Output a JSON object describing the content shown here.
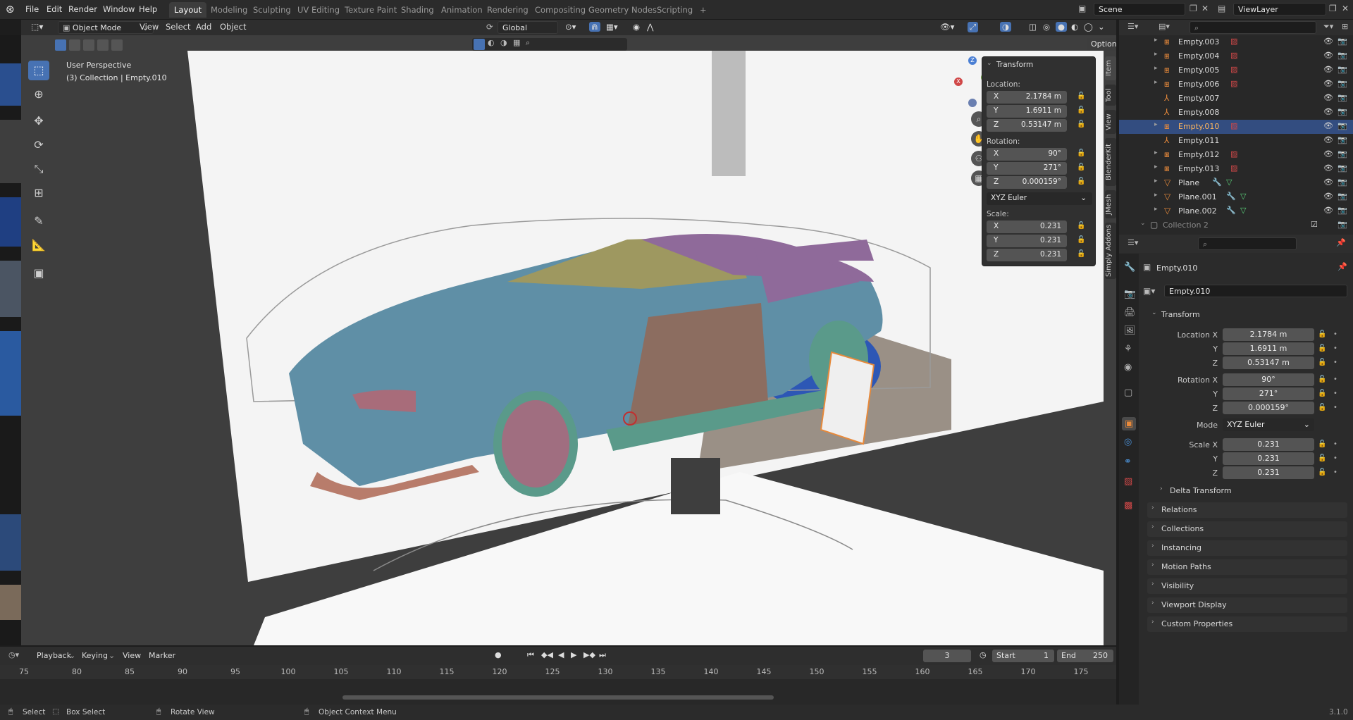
{
  "topbar": {
    "menus": [
      "File",
      "Edit",
      "Render",
      "Window",
      "Help"
    ],
    "workspaces": [
      "Layout",
      "Modeling",
      "Sculpting",
      "UV Editing",
      "Texture Paint",
      "Shading",
      "Animation",
      "Rendering",
      "Compositing",
      "Geometry Nodes",
      "Scripting"
    ],
    "active_workspace": "Layout",
    "add_tab": "+",
    "scene": "Scene",
    "view_layer": "ViewLayer"
  },
  "viewport_header": {
    "mode": "Object Mode",
    "menus": [
      "View",
      "Select",
      "Add",
      "Object"
    ],
    "orientation": "Global",
    "options": "Options"
  },
  "viewport": {
    "perspective": "User Perspective",
    "collection_info": "(3) Collection | Empty.010"
  },
  "npanel": {
    "title": "Transform",
    "location_label": "Location:",
    "location": [
      {
        "axis": "X",
        "value": "2.1784 m"
      },
      {
        "axis": "Y",
        "value": "1.6911 m"
      },
      {
        "axis": "Z",
        "value": "0.53147 m"
      }
    ],
    "rotation_label": "Rotation:",
    "rotation": [
      {
        "axis": "X",
        "value": "90°"
      },
      {
        "axis": "Y",
        "value": "271°"
      },
      {
        "axis": "Z",
        "value": "0.000159°"
      }
    ],
    "rotation_mode": "XYZ Euler",
    "scale_label": "Scale:",
    "scale": [
      {
        "axis": "X",
        "value": "0.231"
      },
      {
        "axis": "Y",
        "value": "0.231"
      },
      {
        "axis": "Z",
        "value": "0.231"
      }
    ],
    "tabs": [
      "Item",
      "Tool",
      "View",
      "BlenderKit",
      "JMesh",
      "Simply Addons"
    ]
  },
  "outliner": {
    "rows": [
      {
        "name": "Empty.003",
        "kind": "empty-image",
        "expand": true
      },
      {
        "name": "Empty.004",
        "kind": "empty-image",
        "expand": true
      },
      {
        "name": "Empty.005",
        "kind": "empty-image",
        "expand": true
      },
      {
        "name": "Empty.006",
        "kind": "empty-image",
        "expand": true
      },
      {
        "name": "Empty.007",
        "kind": "empty",
        "expand": false
      },
      {
        "name": "Empty.008",
        "kind": "empty",
        "expand": false
      },
      {
        "name": "Empty.010",
        "kind": "empty-image",
        "expand": true,
        "selected": true
      },
      {
        "name": "Empty.011",
        "kind": "empty",
        "expand": false
      },
      {
        "name": "Empty.012",
        "kind": "empty-image",
        "expand": true
      },
      {
        "name": "Empty.013",
        "kind": "empty-image",
        "expand": true
      },
      {
        "name": "Plane",
        "kind": "mesh",
        "expand": true
      },
      {
        "name": "Plane.001",
        "kind": "mesh",
        "expand": true
      },
      {
        "name": "Plane.002",
        "kind": "mesh",
        "expand": true
      }
    ],
    "collection2": "Collection 2"
  },
  "properties": {
    "object_name": "Empty.010",
    "data_name": "Empty.010",
    "transform_title": "Transform",
    "location": {
      "x_label": "Location X",
      "y_label": "Y",
      "z_label": "Z",
      "x": "2.1784 m",
      "y": "1.6911 m",
      "z": "0.53147 m"
    },
    "rotation": {
      "x_label": "Rotation X",
      "y_label": "Y",
      "z_label": "Z",
      "x": "90°",
      "y": "271°",
      "z": "0.000159°"
    },
    "mode_label": "Mode",
    "mode": "XYZ Euler",
    "scale": {
      "x_label": "Scale X",
      "y_label": "Y",
      "z_label": "Z",
      "x": "0.231",
      "y": "0.231",
      "z": "0.231"
    },
    "delta_transform": "Delta Transform",
    "sections": [
      "Relations",
      "Collections",
      "Instancing",
      "Motion Paths",
      "Visibility",
      "Viewport Display",
      "Custom Properties"
    ]
  },
  "timeline": {
    "menus": [
      "Playback",
      "Keying",
      "View",
      "Marker"
    ],
    "current_frame": "3",
    "start_label": "Start",
    "start": "1",
    "end_label": "End",
    "end": "250",
    "ticks": [
      "75",
      "80",
      "85",
      "90",
      "95",
      "100",
      "105",
      "110",
      "115",
      "120",
      "125",
      "130",
      "135",
      "140",
      "145",
      "150",
      "155",
      "160",
      "165",
      "170",
      "175"
    ]
  },
  "statusbar": {
    "select": "Select",
    "box_select": "Box Select",
    "rotate_view": "Rotate View",
    "context_menu": "Object Context Menu",
    "version": "3.1.0"
  },
  "colors": {
    "accent": "#4772b3",
    "selection": "#334d80",
    "object_orange": "#e6893b",
    "mesh_green": "#5bd07a"
  }
}
